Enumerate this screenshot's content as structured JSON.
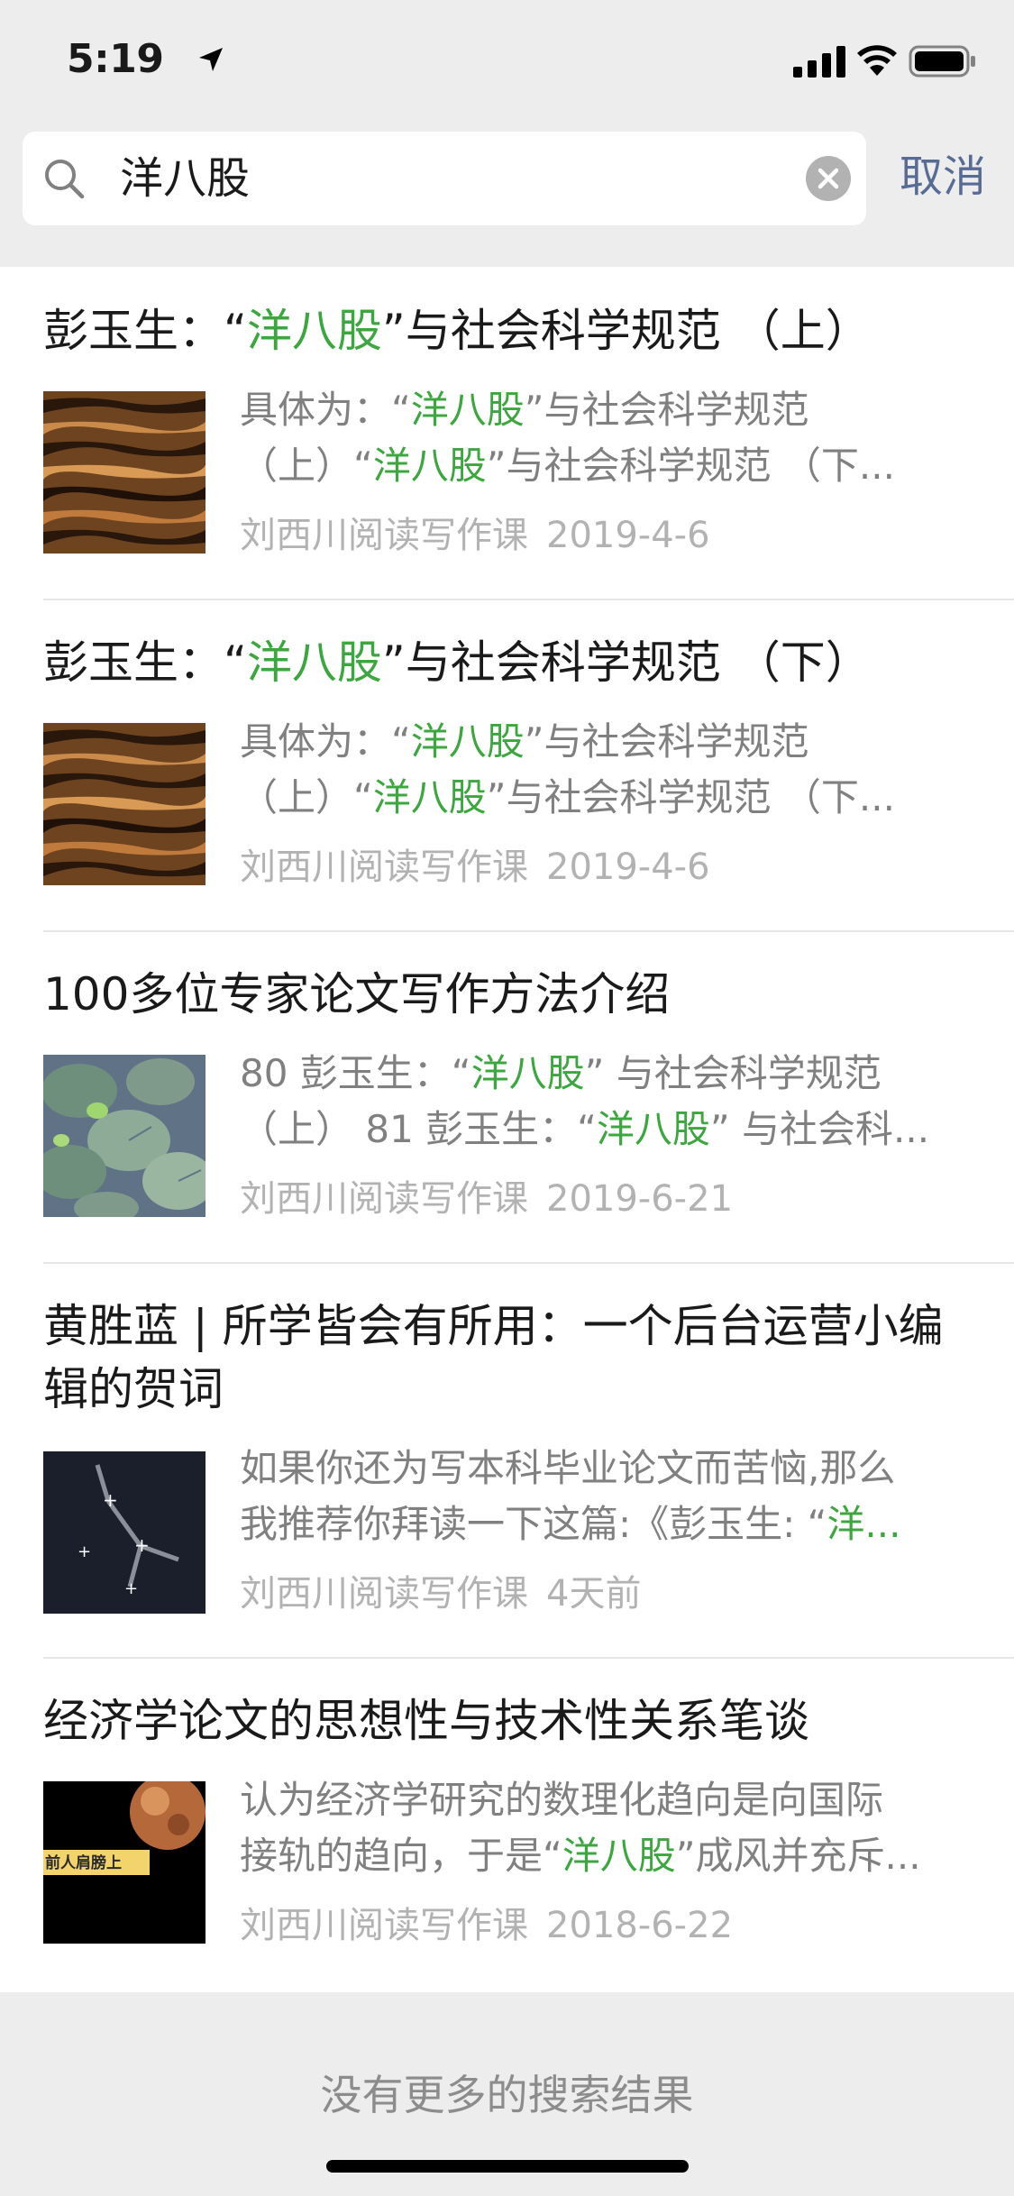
{
  "status_bar": {
    "time": "5:19"
  },
  "search": {
    "query": "洋八股",
    "cancel_label": "取消"
  },
  "results": [
    {
      "title": [
        "彭玉生：“",
        "洋八股",
        "”与社会科学规范 （上）"
      ],
      "snippet_line1": [
        "具体为：“",
        "洋八股",
        "”与社会科学规范"
      ],
      "snippet_line2": [
        "（上）“",
        "洋八股",
        "”与社会科学规范 （下..."
      ],
      "source": "刘西川阅读写作课",
      "date": "2019-4-6",
      "thumbnail": "wood-texture"
    },
    {
      "title": [
        "彭玉生：“",
        "洋八股",
        "”与社会科学规范 （下）"
      ],
      "snippet_line1": [
        "具体为：“",
        "洋八股",
        "”与社会科学规范"
      ],
      "snippet_line2": [
        "（上）“",
        "洋八股",
        "”与社会科学规范 （下..."
      ],
      "source": "刘西川阅读写作课",
      "date": "2019-4-6",
      "thumbnail": "wood-texture"
    },
    {
      "title": "100多位专家论文写作方法介绍",
      "snippet_line1": [
        "80 彭玉生：“",
        "洋八股",
        "” 与社会科学规范"
      ],
      "snippet_line2": [
        "（上） 81 彭玉生：“",
        "洋八股",
        "” 与社会科..."
      ],
      "source": "刘西川阅读写作课",
      "date": "2019-6-21",
      "thumbnail": "lily-pads"
    },
    {
      "title": "黄胜蓝 | 所学皆会有所用：一个后台运营小编辑的贺词",
      "snippet_line1": "如果你还为写本科毕业论文而苦恼,那么",
      "snippet_line2": [
        "我推荐你拜读一下这篇:《彭玉生: “",
        "洋..."
      ],
      "source": "刘西川阅读写作课",
      "date": "4天前",
      "thumbnail": "constellation"
    },
    {
      "title": "经济学论文的思想性与技术性关系笔谈",
      "snippet_line1": "认为经济学研究的数理化趋向是向国际",
      "snippet_line2": [
        "接轨的趋向，于是“",
        "洋八股",
        "”成风并充斥..."
      ],
      "source": "刘西川阅读写作课",
      "date": "2018-6-22",
      "thumbnail": "moon",
      "thumbnail_caption": "前人肩膀上"
    }
  ],
  "footer": {
    "no_more_text": "没有更多的搜索结果"
  },
  "colors": {
    "highlight": "#3ca63f",
    "link": "#576b95",
    "meta": "#b2b2b2",
    "snippet": "#808080"
  }
}
